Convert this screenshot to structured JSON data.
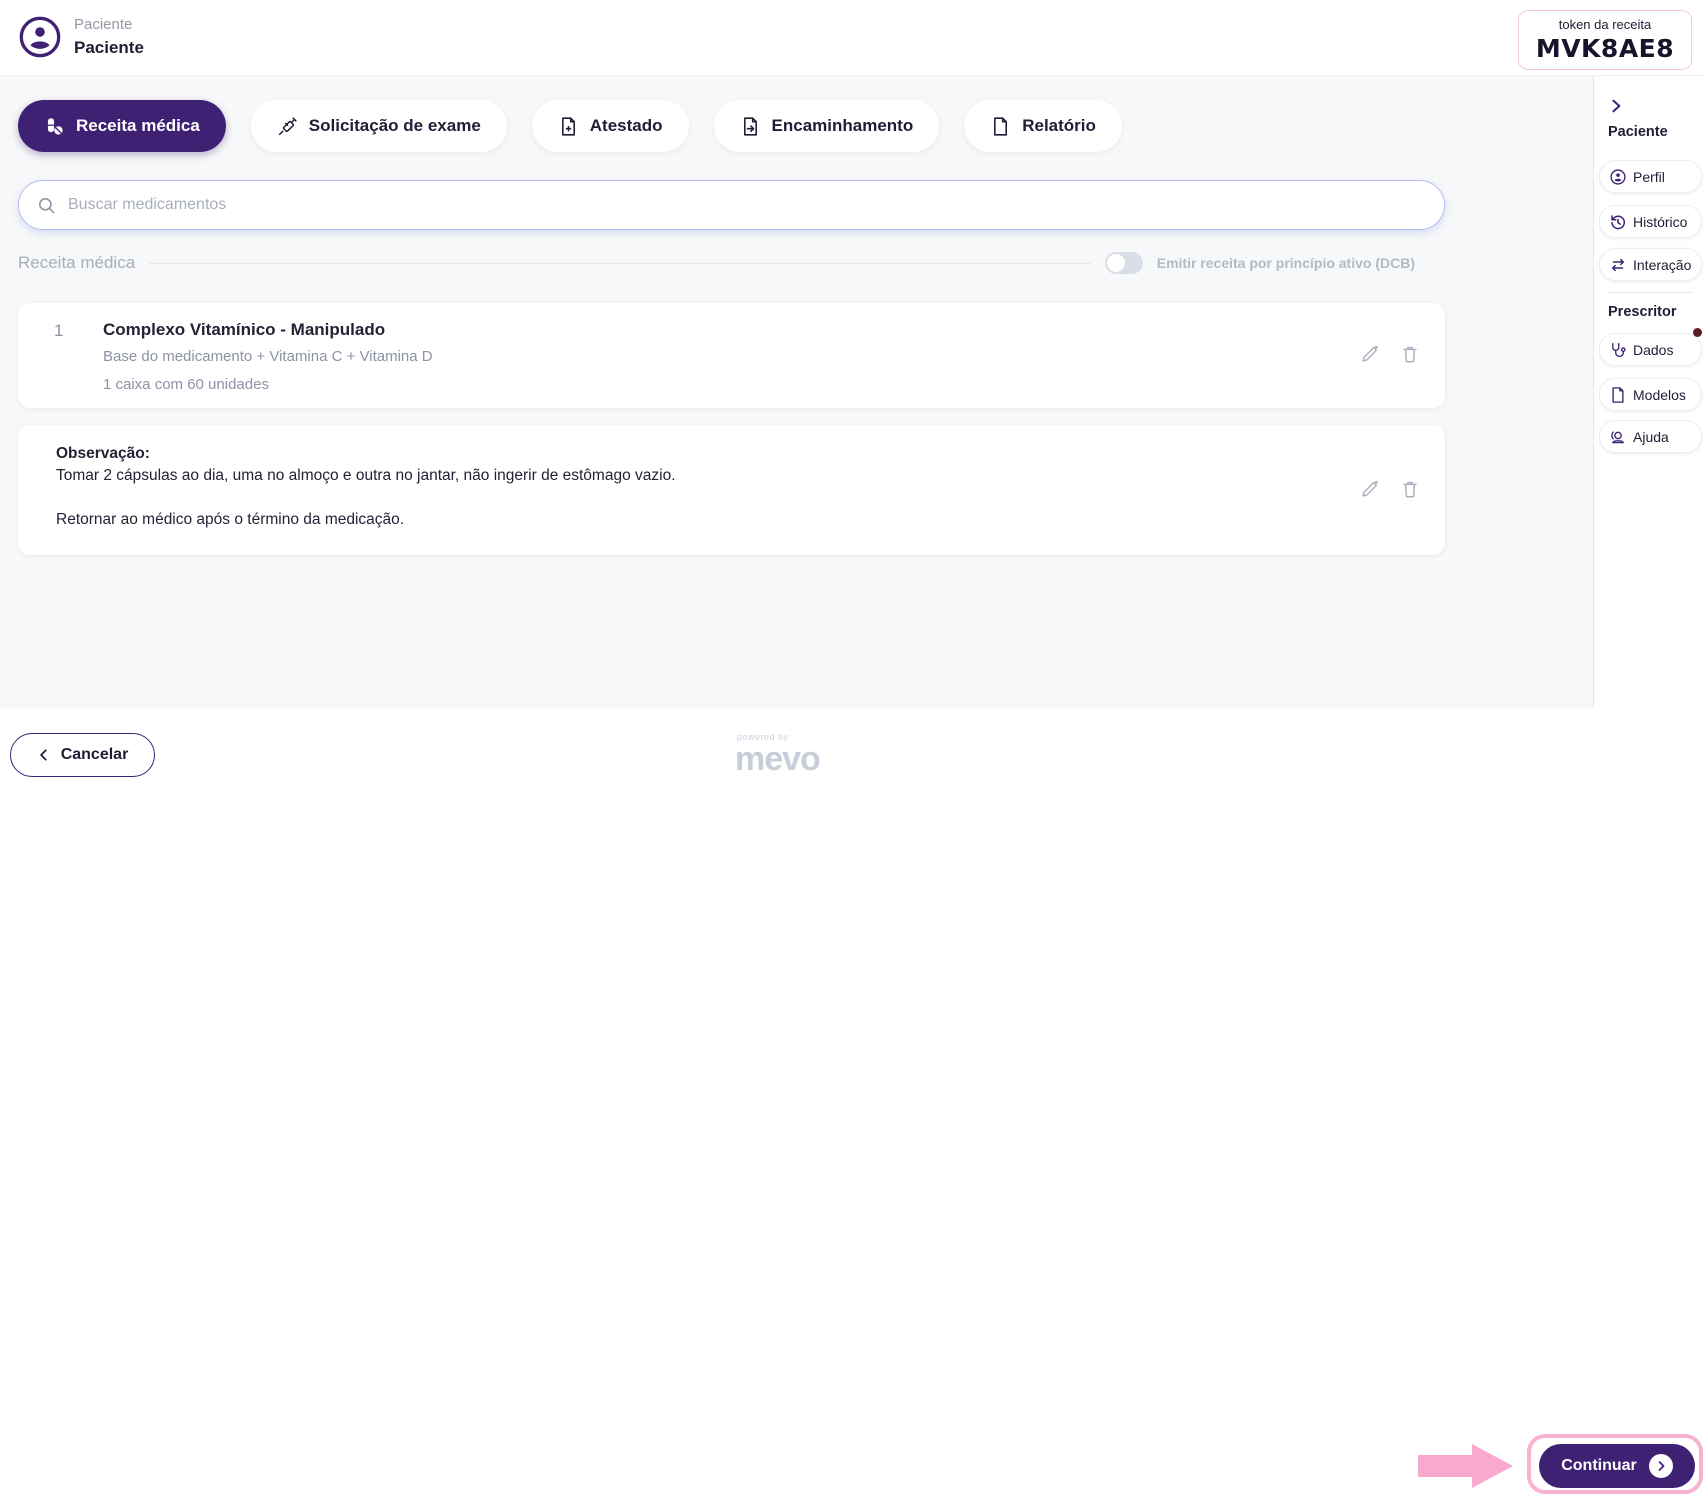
{
  "header": {
    "patient_label": "Paciente",
    "patient_name": "Paciente",
    "token_label": "token da receita",
    "token_value": "MVK8AE8"
  },
  "tabs": [
    {
      "label": "Receita médica",
      "icon": "pills-icon",
      "active": true
    },
    {
      "label": "Solicitação de exame",
      "icon": "syringe-icon",
      "active": false
    },
    {
      "label": "Atestado",
      "icon": "document-plus-icon",
      "active": false
    },
    {
      "label": "Encaminhamento",
      "icon": "document-arrow-icon",
      "active": false
    },
    {
      "label": "Relatório",
      "icon": "document-icon",
      "active": false
    }
  ],
  "search": {
    "placeholder": "Buscar medicamentos"
  },
  "section": {
    "title": "Receita médica",
    "toggle_label": "Emitir receita por princípio ativo (DCB)",
    "toggle_on": false
  },
  "medication": {
    "index": "1",
    "title": "Complexo Vitamínico - Manipulado",
    "composition": "Base do medicamento + Vitamina C + Vitamina D",
    "quantity": "1 caixa com 60 unidades"
  },
  "observation": {
    "label": "Observação:",
    "line1": "Tomar 2 cápsulas ao dia, uma no almoço e outra no jantar, não ingerir de estômago vazio.",
    "line2": "Retornar ao médico após o término da medicação."
  },
  "sidebar": {
    "patient_title": "Paciente",
    "prescriber_title": "Prescritor",
    "patient_items": [
      {
        "label": "Perfil",
        "icon": "person-circle-icon"
      },
      {
        "label": "Histórico",
        "icon": "history-icon"
      },
      {
        "label": "Interação",
        "icon": "interaction-arrows-icon"
      }
    ],
    "prescriber_items": [
      {
        "label": "Dados",
        "icon": "stethoscope-icon",
        "notification": true
      },
      {
        "label": "Modelos",
        "icon": "document-icon",
        "notification": false
      },
      {
        "label": "Ajuda",
        "icon": "support-person-icon",
        "notification": false
      }
    ]
  },
  "footer": {
    "cancel_label": "Cancelar",
    "continue_label": "Continuar",
    "powered_by": "powered by",
    "brand": "mevo"
  },
  "colors": {
    "primary_purple": "#3e2173",
    "annotation_pink": "#f8a9cd",
    "token_border_pink": "#f7c9d9",
    "toggle_off_gray": "#d9dde6",
    "notification_dot": "#5c1a22"
  }
}
